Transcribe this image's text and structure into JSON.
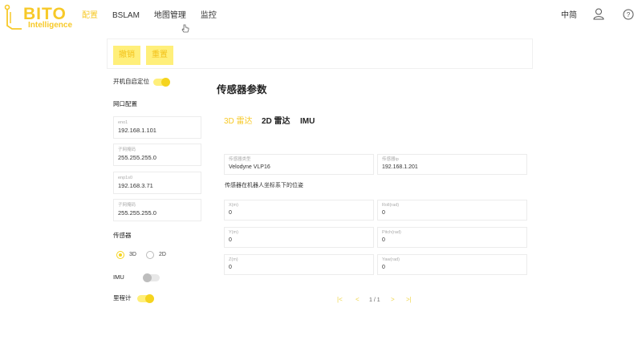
{
  "header": {
    "logo": {
      "big": "BITO",
      "small": "Intelligence"
    },
    "nav": [
      {
        "label": "配置",
        "active": true
      },
      {
        "label": "BSLAM",
        "active": false
      },
      {
        "label": "地图管理",
        "active": false
      },
      {
        "label": "监控",
        "active": false
      }
    ],
    "lang": "中简",
    "icons": {
      "user": "user-icon",
      "help": "help-icon",
      "cursor": "hand-pointer-icon",
      "logo": "circuit-logo-icon"
    }
  },
  "actions": {
    "btn1": "撤销",
    "btn2": "重置"
  },
  "sidebar": {
    "auto_locate": {
      "label": "开机自启定位",
      "on": true
    },
    "network_title": "网口配置",
    "fields": [
      {
        "label": "eno1",
        "value": "192.168.1.101"
      },
      {
        "label": "子网掩码",
        "value": "255.255.255.0"
      },
      {
        "label": "enp1s0",
        "value": "192.168.3.71"
      },
      {
        "label": "子网掩码",
        "value": "255.255.255.0"
      }
    ],
    "sensor_title": "传感器",
    "sensor_options": [
      {
        "label": "3D",
        "selected": true
      },
      {
        "label": "2D",
        "selected": false
      }
    ],
    "imu": {
      "label": "IMU",
      "on": false
    },
    "odometer": {
      "label": "里程计",
      "on": true
    }
  },
  "main": {
    "title": "传感器参数",
    "tabs": [
      {
        "label": "3D 雷达",
        "active": true
      },
      {
        "label": "2D 雷达",
        "active": false
      },
      {
        "label": "IMU",
        "active": false
      }
    ],
    "sensor_type": {
      "label": "传感器类型",
      "value": "Velodyne VLP16"
    },
    "sensor_ip": {
      "label": "传感器ip",
      "value": "192.168.1.201"
    },
    "pose_title": "传感器在机器人坐标系下的位姿",
    "pose": [
      {
        "label": "X(m)",
        "value": "0"
      },
      {
        "label": "Roll(rad)",
        "value": "0"
      },
      {
        "label": "Y(m)",
        "value": "0"
      },
      {
        "label": "Pitch(rad)",
        "value": "0"
      },
      {
        "label": "Z(m)",
        "value": "0"
      },
      {
        "label": "Yaw(rad)",
        "value": "0"
      }
    ],
    "pagination": {
      "first": "|<",
      "prev": "<",
      "page": "1 / 1",
      "next": ">",
      "last": ">|"
    }
  },
  "colors": {
    "accent": "#f7c928",
    "button_bg": "#ffef7a",
    "border": "#ececec"
  }
}
